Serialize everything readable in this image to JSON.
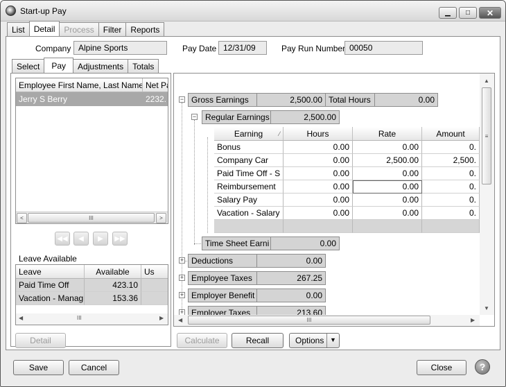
{
  "window": {
    "title": "Start-up Pay"
  },
  "top_tabs": [
    {
      "label": "List",
      "state": "normal"
    },
    {
      "label": "Detail",
      "state": "active"
    },
    {
      "label": "Process",
      "state": "disabled"
    },
    {
      "label": "Filter",
      "state": "normal"
    },
    {
      "label": "Reports",
      "state": "normal"
    }
  ],
  "header": {
    "company_label": "Company",
    "company_value": "Alpine Sports",
    "pay_date_label": "Pay Date",
    "pay_date_value": "12/31/09",
    "pay_run_label": "Pay Run Number",
    "pay_run_value": "00050"
  },
  "sub_tabs": [
    {
      "label": "Select",
      "state": "normal"
    },
    {
      "label": "Pay",
      "state": "active"
    },
    {
      "label": "Adjustments",
      "state": "normal"
    },
    {
      "label": "Totals",
      "state": "normal"
    }
  ],
  "employee_grid": {
    "columns": [
      "Employee First Name, Last Name",
      "Net Pa"
    ],
    "rows": [
      {
        "name": "Jerry S Berry",
        "net": "2232."
      }
    ],
    "scroll_thumb_glyph": "III"
  },
  "nav_buttons": [
    "first-icon",
    "prev-icon",
    "next-icon",
    "last-icon"
  ],
  "leave": {
    "title": "Leave Available",
    "columns": [
      "Leave",
      "Available",
      "Us"
    ],
    "rows": [
      {
        "leave": "Paid Time Off",
        "available": "423.10"
      },
      {
        "leave": "Vacation - Manag",
        "available": "153.36"
      }
    ]
  },
  "detail_button": "Detail",
  "earnings": {
    "gross": {
      "label": "Gross Earnings",
      "value": "2,500.00",
      "hours_label": "Total Hours",
      "hours_value": "0.00"
    },
    "regular": {
      "label": "Regular Earnings",
      "value": "2,500.00"
    },
    "columns": [
      "Earning",
      "Hours",
      "Rate",
      "Amount"
    ],
    "rows": [
      {
        "earning": "Bonus",
        "hours": "0.00",
        "rate": "0.00",
        "amount": "0."
      },
      {
        "earning": "Company Car",
        "hours": "0.00",
        "rate": "2,500.00",
        "amount": "2,500."
      },
      {
        "earning": "Paid Time Off - S",
        "hours": "0.00",
        "rate": "0.00",
        "amount": "0."
      },
      {
        "earning": "Reimbursement",
        "hours": "0.00",
        "rate": "0.00",
        "amount": "0."
      },
      {
        "earning": "Salary Pay",
        "hours": "0.00",
        "rate": "0.00",
        "amount": "0."
      },
      {
        "earning": "Vacation - Salary",
        "hours": "0.00",
        "rate": "0.00",
        "amount": "0."
      }
    ],
    "timesheet": {
      "label": "Time Sheet Earni",
      "value": "0.00"
    },
    "groups": [
      {
        "label": "Deductions",
        "value": "0.00"
      },
      {
        "label": "Employee Taxes",
        "value": "267.25"
      },
      {
        "label": "Employer Benefit",
        "value": "0.00"
      },
      {
        "label": "Employer Taxes",
        "value": "213.60"
      }
    ]
  },
  "buttons": {
    "calculate": "Calculate",
    "recall": "Recall",
    "options": "Options",
    "save": "Save",
    "cancel": "Cancel",
    "close": "Close",
    "help": "?"
  }
}
